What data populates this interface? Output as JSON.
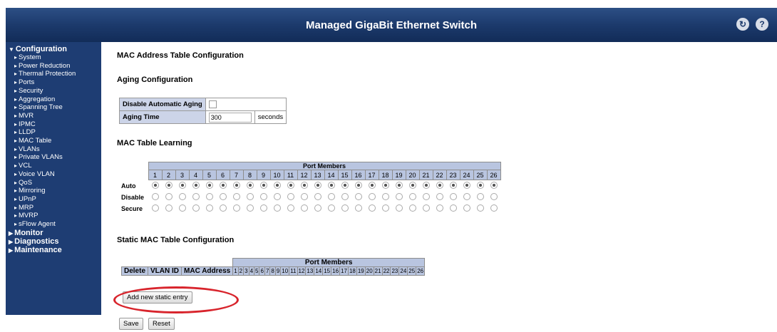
{
  "header": {
    "title": "Managed GigaBit Ethernet Switch",
    "icons": [
      "logout-icon",
      "help-icon"
    ]
  },
  "sidebar": {
    "configuration": "Configuration",
    "items": [
      "System",
      "Power Reduction",
      "Thermal Protection",
      "Ports",
      "Security",
      "Aggregation",
      "Spanning Tree",
      "MVR",
      "IPMC",
      "LLDP",
      "MAC Table",
      "VLANs",
      "Private VLANs",
      "VCL",
      "Voice VLAN",
      "QoS",
      "Mirroring",
      "UPnP",
      "MRP",
      "MVRP",
      "sFlow Agent"
    ],
    "monitor": "Monitor",
    "diagnostics": "Diagnostics",
    "maintenance": "Maintenance"
  },
  "page_title": "MAC Address Table Configuration",
  "aging": {
    "heading": "Aging Configuration",
    "disable_label": "Disable Automatic Aging",
    "time_label": "Aging Time",
    "time_value": "300",
    "unit": "seconds"
  },
  "learning": {
    "heading": "MAC Table Learning",
    "port_members": "Port Members",
    "ports": [
      "1",
      "2",
      "3",
      "4",
      "5",
      "6",
      "7",
      "8",
      "9",
      "10",
      "11",
      "12",
      "13",
      "14",
      "15",
      "16",
      "17",
      "18",
      "19",
      "20",
      "21",
      "22",
      "23",
      "24",
      "25",
      "26"
    ],
    "rows": [
      "Auto",
      "Disable",
      "Secure"
    ],
    "selected": "Auto"
  },
  "static": {
    "heading": "Static MAC Table Configuration",
    "delete": "Delete",
    "vlan_id": "VLAN ID",
    "mac_address": "MAC Address",
    "port_members": "Port Members",
    "ports": [
      "1",
      "2",
      "3",
      "4",
      "5",
      "6",
      "7",
      "8",
      "9",
      "10",
      "11",
      "12",
      "13",
      "14",
      "15",
      "16",
      "17",
      "18",
      "19",
      "20",
      "21",
      "22",
      "23",
      "24",
      "25",
      "26"
    ]
  },
  "buttons": {
    "add_entry": "Add new static entry",
    "save": "Save",
    "reset": "Reset"
  },
  "colors": {
    "banner": "#1c3a6c",
    "table_header": "#b9c5e0",
    "highlight": "#d8242c"
  }
}
